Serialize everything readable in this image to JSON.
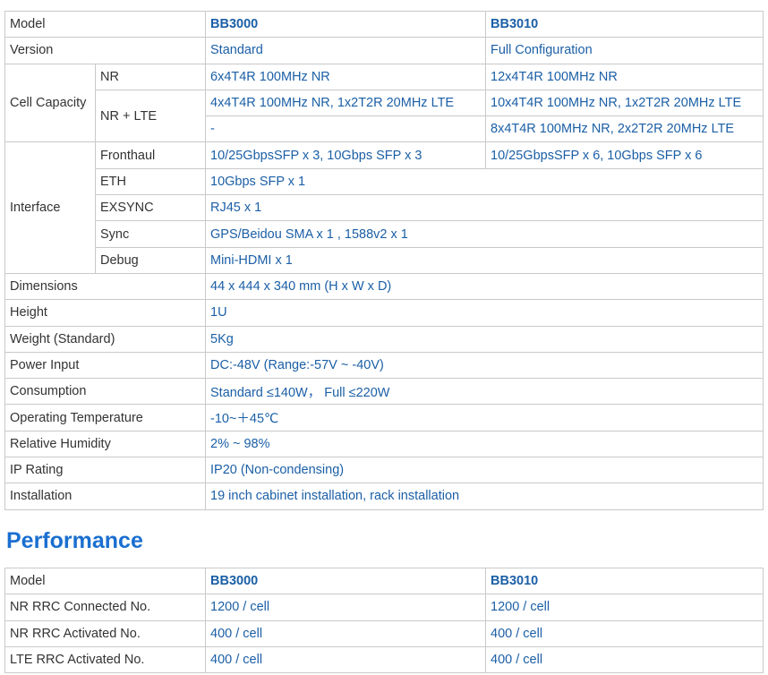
{
  "spec": {
    "header": {
      "label": "Model",
      "col1": "BB3000",
      "col2": "BB3010"
    },
    "version": {
      "label": "Version",
      "col1": "Standard",
      "col2": "Full Configuration"
    },
    "cell_capacity": {
      "label": "Cell Capacity",
      "nr": {
        "label": "NR",
        "col1": "6x4T4R 100MHz NR",
        "col2": "12x4T4R 100MHz NR"
      },
      "nr_lte": {
        "label": "NR + LTE",
        "col1_a": "4x4T4R 100MHz NR, 1x2T2R 20MHz LTE",
        "col2_a": "10x4T4R 100MHz NR, 1x2T2R 20MHz LTE",
        "col1_b": "-",
        "col2_b": "8x4T4R 100MHz NR, 2x2T2R 20MHz LTE"
      }
    },
    "interface": {
      "label": "Interface",
      "fronthaul": {
        "label": "Fronthaul",
        "col1": "10/25GbpsSFP x 3, 10Gbps SFP x 3",
        "col2": "10/25GbpsSFP x 6, 10Gbps SFP x 6"
      },
      "eth": {
        "label": "ETH",
        "value": "10Gbps SFP x 1"
      },
      "exsync": {
        "label": "EXSYNC",
        "value": "RJ45 x 1"
      },
      "sync": {
        "label": "Sync",
        "value": "GPS/Beidou SMA x 1 , 1588v2 x 1"
      },
      "debug": {
        "label": "Debug",
        "value": "Mini-HDMI x 1"
      }
    },
    "dimensions": {
      "label": "Dimensions",
      "value": "44 x 444 x 340 mm (H x W x D)"
    },
    "height": {
      "label": "Height",
      "value": "1U"
    },
    "weight": {
      "label": "Weight (Standard)",
      "value": "5Kg"
    },
    "power": {
      "label": "Power Input",
      "value": "DC:-48V (Range:-57V ~ -40V)"
    },
    "consumption": {
      "label": "Consumption",
      "value": "Standard ≤140W， Full ≤220W"
    },
    "temperature": {
      "label": "Operating Temperature",
      "value": "-10~＋45℃"
    },
    "humidity": {
      "label": "Relative Humidity",
      "value": "2% ~ 98%"
    },
    "ip_rating": {
      "label": "IP Rating",
      "value": "IP20 (Non-condensing)"
    },
    "installation": {
      "label": "Installation",
      "value": "19 inch cabinet installation, rack installation"
    }
  },
  "performance": {
    "title": "Performance",
    "header": {
      "label": "Model",
      "col1": "BB3000",
      "col2": "BB3010"
    },
    "rows": [
      {
        "label": "NR RRC Connected No.",
        "col1": "1200 / cell",
        "col2": "1200 / cell"
      },
      {
        "label": "NR RRC Activated No.",
        "col1": "400 / cell",
        "col2": "400 / cell"
      },
      {
        "label": "LTE RRC Activated No.",
        "col1": "400 / cell",
        "col2": "400 / cell"
      }
    ]
  }
}
